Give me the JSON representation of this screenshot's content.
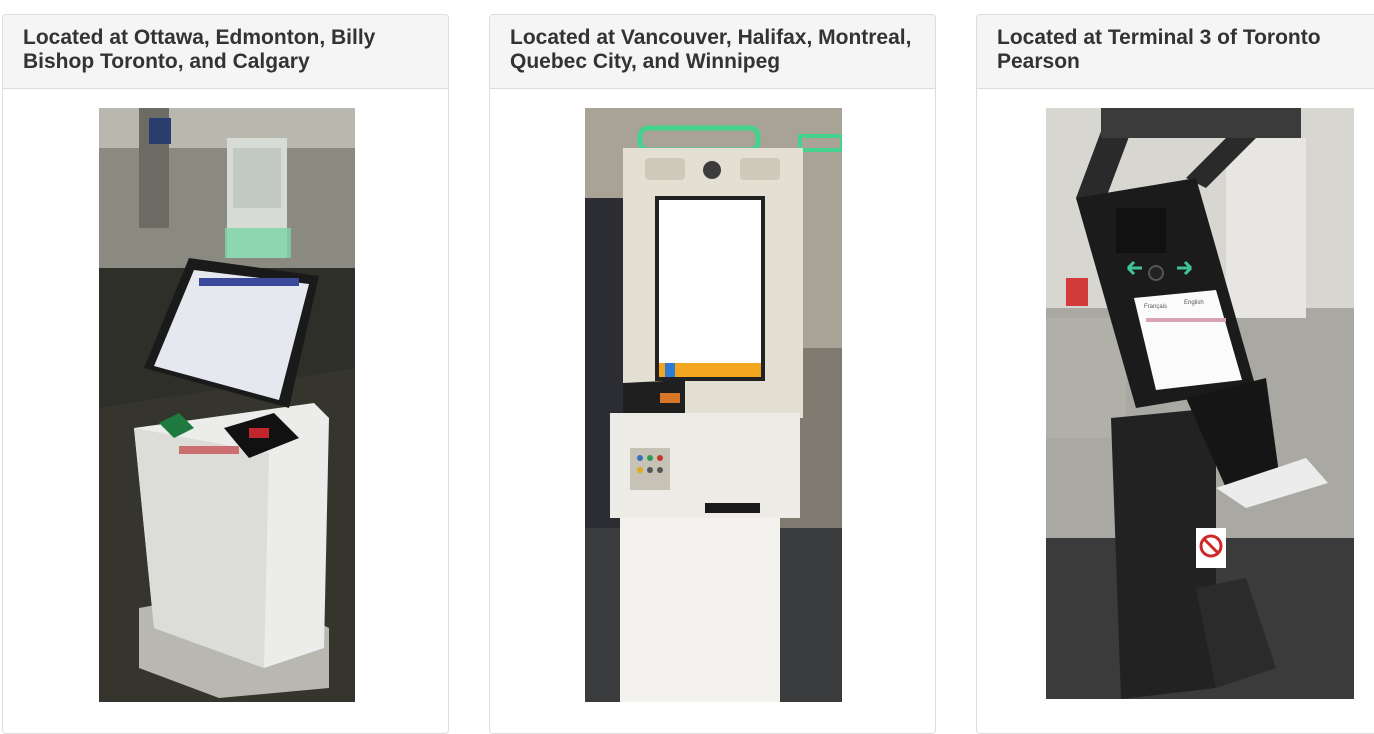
{
  "panels": [
    {
      "title": "Located at Ottawa, Edmonton, Billy Bishop Toronto, and Calgary",
      "image_description": "Primary inspection kiosk with touch screen, passport reader and camera mast"
    },
    {
      "title": "Located at Vancouver, Halifax, Montreal, Quebec City, and Winnipeg",
      "image_description": "White kiosk with green-lit top, camera bar, tall touch screen and keypad"
    },
    {
      "title": "Located at Terminal 3 of Toronto Pearson",
      "image_description": "Black kiosk with angled screen, camera with green arrows and fold-out tray"
    }
  ],
  "kiosk2": {
    "screen_colors": [
      "#2e7bd6",
      "#f3a51e"
    ]
  },
  "kiosk3": {
    "screen_text_left": "Français",
    "screen_text_right": "English"
  }
}
